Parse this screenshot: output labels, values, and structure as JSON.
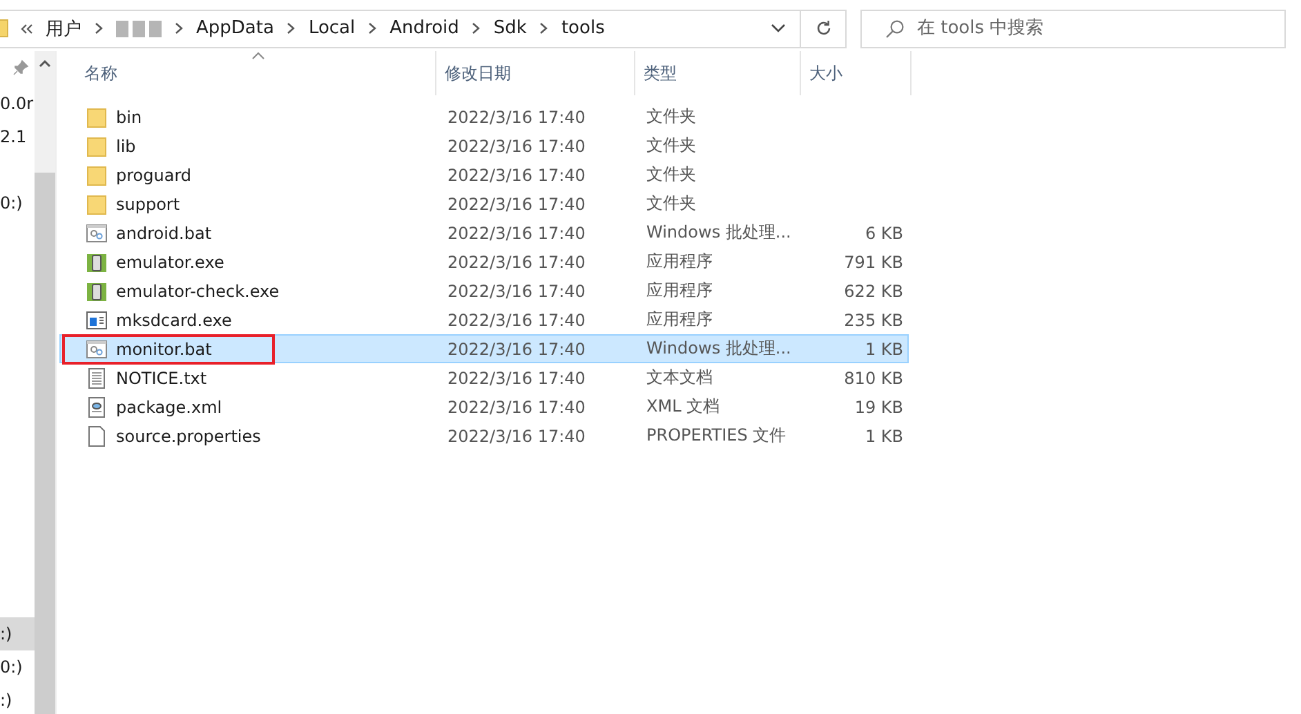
{
  "address_bar": {
    "crumbs": [
      {
        "kind": "text",
        "label": "用户"
      },
      {
        "kind": "redacted"
      },
      {
        "kind": "text",
        "label": "AppData"
      },
      {
        "kind": "text",
        "label": "Local"
      },
      {
        "kind": "text",
        "label": "Android"
      },
      {
        "kind": "text",
        "label": "Sdk"
      },
      {
        "kind": "text",
        "label": "tools"
      }
    ]
  },
  "search": {
    "placeholder": "在 tools 中搜索"
  },
  "nav_pane": {
    "items": [
      {
        "label": "0.0r",
        "selected": false
      },
      {
        "label": "2.1",
        "selected": false
      },
      {
        "label": "0:)",
        "selected": false
      },
      {
        "label": ":)",
        "selected": true
      },
      {
        "label": "0:)",
        "selected": false
      },
      {
        "label": ":)",
        "selected": false
      }
    ]
  },
  "table": {
    "columns": [
      "名称",
      "修改日期",
      "类型",
      "大小"
    ],
    "rows": [
      {
        "kind": "folder",
        "name": "bin",
        "date": "2022/3/16 17:40",
        "type": "文件夹",
        "size": "",
        "selected": false,
        "outlined": false
      },
      {
        "kind": "folder",
        "name": "lib",
        "date": "2022/3/16 17:40",
        "type": "文件夹",
        "size": "",
        "selected": false,
        "outlined": false
      },
      {
        "kind": "folder",
        "name": "proguard",
        "date": "2022/3/16 17:40",
        "type": "文件夹",
        "size": "",
        "selected": false,
        "outlined": false
      },
      {
        "kind": "folder",
        "name": "support",
        "date": "2022/3/16 17:40",
        "type": "文件夹",
        "size": "",
        "selected": false,
        "outlined": false
      },
      {
        "kind": "batch",
        "name": "android.bat",
        "date": "2022/3/16 17:40",
        "type": "Windows 批处理...",
        "size": "6 KB",
        "selected": false,
        "outlined": false
      },
      {
        "kind": "phone",
        "name": "emulator.exe",
        "date": "2022/3/16 17:40",
        "type": "应用程序",
        "size": "791 KB",
        "selected": false,
        "outlined": false
      },
      {
        "kind": "phone",
        "name": "emulator-check.exe",
        "date": "2022/3/16 17:40",
        "type": "应用程序",
        "size": "622 KB",
        "selected": false,
        "outlined": false
      },
      {
        "kind": "app",
        "name": "mksdcard.exe",
        "date": "2022/3/16 17:40",
        "type": "应用程序",
        "size": "235 KB",
        "selected": false,
        "outlined": false
      },
      {
        "kind": "batch",
        "name": "monitor.bat",
        "date": "2022/3/16 17:40",
        "type": "Windows 批处理...",
        "size": "1 KB",
        "selected": true,
        "outlined": true
      },
      {
        "kind": "text",
        "name": "NOTICE.txt",
        "date": "2022/3/16 17:40",
        "type": "文本文档",
        "size": "810 KB",
        "selected": false,
        "outlined": false
      },
      {
        "kind": "xml",
        "name": "package.xml",
        "date": "2022/3/16 17:40",
        "type": "XML 文档",
        "size": "19 KB",
        "selected": false,
        "outlined": false
      },
      {
        "kind": "blank",
        "name": "source.properties",
        "date": "2022/3/16 17:40",
        "type": "PROPERTIES 文件",
        "size": "1 KB",
        "selected": false,
        "outlined": false
      }
    ]
  }
}
